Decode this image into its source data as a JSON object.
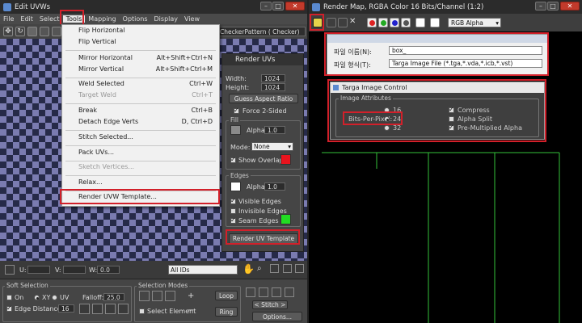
{
  "edit_uvws": {
    "title": "Edit UVWs",
    "menu": [
      "File",
      "Edit",
      "Select",
      "Tools",
      "Mapping",
      "Options",
      "Display",
      "View"
    ],
    "checker_pattern": "CheckerPattern ( Checker)",
    "tools_menu": {
      "items": [
        {
          "label": "Flip Horizontal",
          "shortcut": ""
        },
        {
          "label": "Flip Vertical",
          "shortcut": ""
        },
        {
          "label": "Mirror Horizontal",
          "shortcut": "Alt+Shift+Ctrl+N"
        },
        {
          "label": "Mirror Vertical",
          "shortcut": "Alt+Shift+Ctrl+M"
        },
        {
          "label": "Weld Selected",
          "shortcut": "Ctrl+W"
        },
        {
          "label": "Target Weld",
          "shortcut": "Ctrl+T"
        },
        {
          "label": "Break",
          "shortcut": "Ctrl+B"
        },
        {
          "label": "Detach Edge Verts",
          "shortcut": "D, Ctrl+D"
        },
        {
          "label": "Stitch Selected...",
          "shortcut": ""
        },
        {
          "label": "Pack UVs...",
          "shortcut": ""
        },
        {
          "label": "Sketch Vertices...",
          "shortcut": ""
        },
        {
          "label": "Relax...",
          "shortcut": ""
        },
        {
          "label": "Render UVW Template...",
          "shortcut": ""
        }
      ]
    },
    "bottom_bar": {
      "u_label": "U:",
      "v_label": "V:",
      "w_label": "W:",
      "w_value": "0.0",
      "all_ids": "All IDs"
    },
    "soft_selection": {
      "title": "Soft Selection",
      "on": "On",
      "xy": "XY",
      "uv": "UV",
      "falloff_label": "Falloff:",
      "falloff_value": "25.0",
      "edge_distance": "Edge Distance",
      "edge_value": "16"
    },
    "selection_modes": {
      "title": "Selection Modes",
      "select_element": "Select Element",
      "loop": "Loop",
      "ring": "Ring"
    },
    "stitch": {
      "label": "< Stitch >",
      "options": "Options..."
    }
  },
  "render_uvs": {
    "title": "Render UVs",
    "width_label": "Width:",
    "width_value": "1024",
    "height_label": "Height:",
    "height_value": "1024",
    "guess_aspect": "Guess Aspect Ratio",
    "force_2sided": "Force 2-Sided",
    "fill": {
      "title": "Fill",
      "alpha_label": "Alpha:",
      "alpha_value": "1.0",
      "mode_label": "Mode:",
      "mode_value": "None",
      "show_overlap": "Show Overlap ..."
    },
    "edges": {
      "title": "Edges",
      "alpha_label": "Alpha:",
      "alpha_value": "1.0",
      "visible": "Visible Edges",
      "invisible": "Invisible Edges",
      "seam": "Seam Edges"
    },
    "render_button": "Render UV Template",
    "overlap_color": "#e8141e",
    "seam_color": "#22dd22"
  },
  "render_map": {
    "title": "Render Map, RGBA Color 16 Bits/Channel (1:2)",
    "channel": "RGB Alpha",
    "file_name_label": "파일 이름(N):",
    "file_name_value": "box_",
    "file_type_label": "파일 형식(T):",
    "file_type_value": "Targa Image File (*.tga,*.vda,*.icb,*.vst)"
  },
  "targa": {
    "title": "Targa Image Control",
    "attributes": "Image Attributes",
    "bits_label": "Bits-Per-Pixel:",
    "bits": [
      "16",
      "24",
      "32"
    ],
    "compress": "Compress",
    "alpha_split": "Alpha Split",
    "premultiplied": "Pre-Multiplied Alpha"
  },
  "colors": {
    "highlight": "#d2202a",
    "uv_lines": "#34c23a"
  }
}
